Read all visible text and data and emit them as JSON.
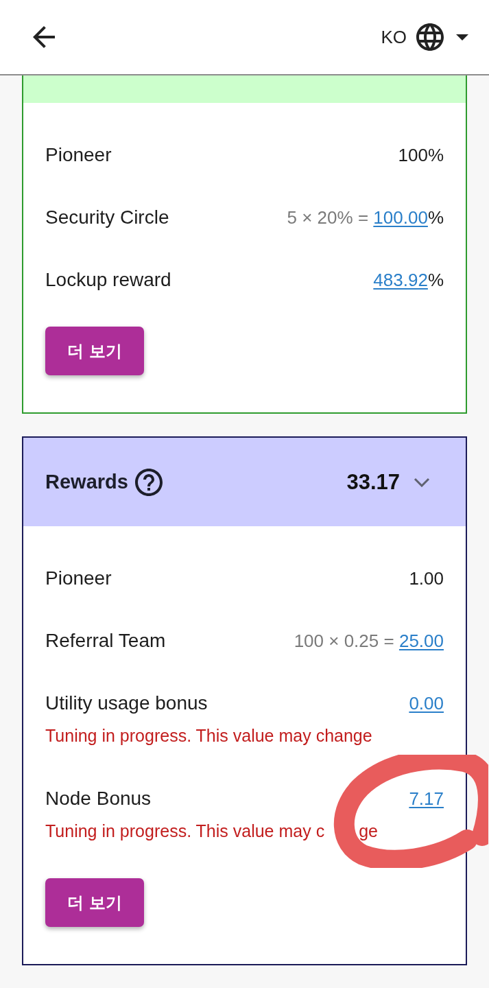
{
  "top_bar": {
    "language": "KO"
  },
  "cards": [
    {
      "color": "#ccffcc",
      "rows": [
        {
          "kind": "plain",
          "label": "Pioneer",
          "value": "100%"
        },
        {
          "kind": "link",
          "label": "Security Circle",
          "formula": "5 × 20% =",
          "link": "100.00",
          "suffix": "%"
        },
        {
          "kind": "link",
          "label": "Lockup reward",
          "link": "483.92",
          "suffix": "%"
        }
      ],
      "button": "더 보기"
    },
    {
      "color": "#ccccff",
      "title": "Rewards",
      "total": "33.17",
      "rows": [
        {
          "kind": "plain",
          "label": "Pioneer",
          "value": "1.00"
        },
        {
          "kind": "link",
          "label": "Referral Team",
          "formula": "100 × 0.25 =",
          "link": "25.00"
        },
        {
          "kind": "link",
          "label": "Utility usage bonus",
          "link": "0.00",
          "warning": [
            "Tuning in progress. This value may change"
          ]
        },
        {
          "kind": "link",
          "label": "Node Bonus",
          "link": "7.17",
          "warning": [
            "Tuning in progress. This value may c",
            "ge"
          ],
          "annotated": true
        }
      ],
      "button": "더 보기"
    }
  ]
}
